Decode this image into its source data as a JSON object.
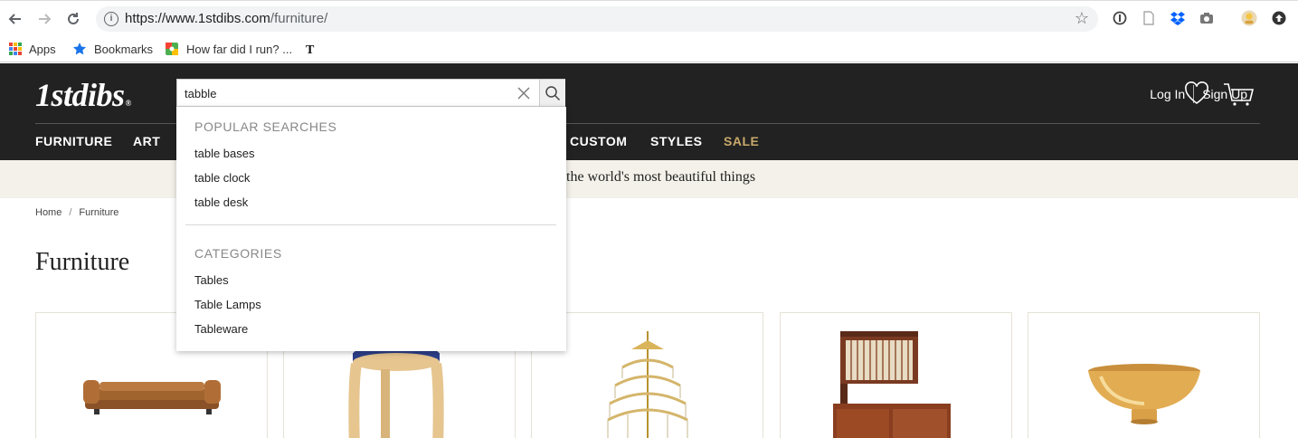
{
  "browser": {
    "url_host": "https://www.1stdibs.com",
    "url_path": "/furniture/",
    "bookmarks": [
      "Apps",
      "Bookmarks",
      "How far did I run? ..."
    ]
  },
  "site": {
    "logo": "1stdibs",
    "logo_mark": "®",
    "login": "Log In",
    "signup": "Sign Up",
    "nav": [
      "FURNITURE",
      "ART",
      "CUSTOM",
      "STYLES",
      "SALE"
    ],
    "promo_text": "the world's most beautiful things",
    "breadcrumb": [
      "Home",
      "Furniture"
    ],
    "page_title": "Furniture"
  },
  "search": {
    "value": "tabble",
    "popular_heading": "POPULAR SEARCHES",
    "popular": [
      "table bases",
      "table clock",
      "table desk"
    ],
    "categories_heading": "CATEGORIES",
    "categories": [
      "Tables",
      "Table Lamps",
      "Tableware"
    ]
  },
  "colors": {
    "header_bg": "#222222",
    "sale": "#c8a96b",
    "promo_bg": "#f3f1e9"
  },
  "icons": {
    "back": "arrow-left",
    "forward": "arrow-right",
    "reload": "refresh",
    "info": "info-circle",
    "star": "star",
    "heart": "heart-outline",
    "cart": "cart"
  }
}
